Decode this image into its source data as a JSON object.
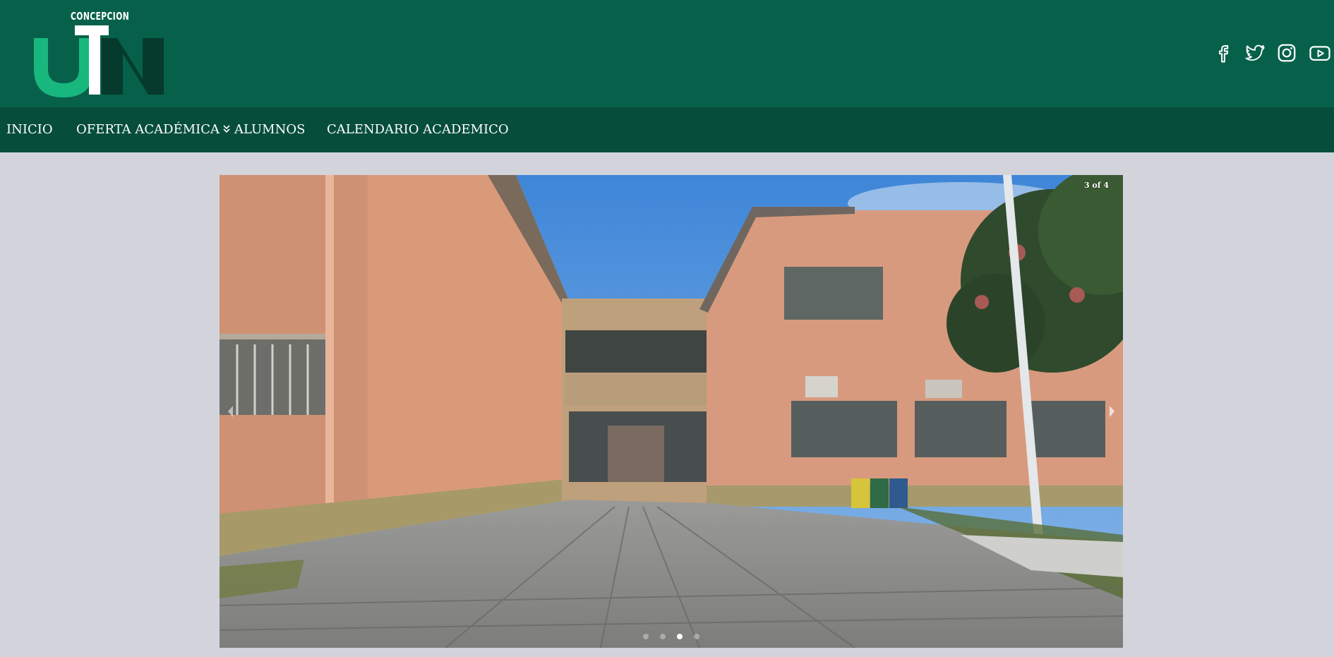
{
  "brand": {
    "caption": "CONCEPCION",
    "primary_color": "#07614a",
    "nav_color": "#064d3b",
    "logo_green": "#18b77e"
  },
  "social": [
    {
      "name": "facebook-icon"
    },
    {
      "name": "twitter-icon"
    },
    {
      "name": "instagram-icon"
    },
    {
      "name": "youtube-icon"
    }
  ],
  "nav": {
    "items": [
      {
        "label": "INICIO"
      },
      {
        "label": "OFERTA ACADÉMICA",
        "has_dropdown": true,
        "icon": "double-chevron-down-icon"
      },
      {
        "label": "ALUMNOS"
      },
      {
        "label": "CALENDARIO ACADEMICO"
      }
    ]
  },
  "carousel": {
    "counter": "3 of 4",
    "slide_count": 4,
    "active_index": 2,
    "image_description": "building-facade-photo"
  }
}
